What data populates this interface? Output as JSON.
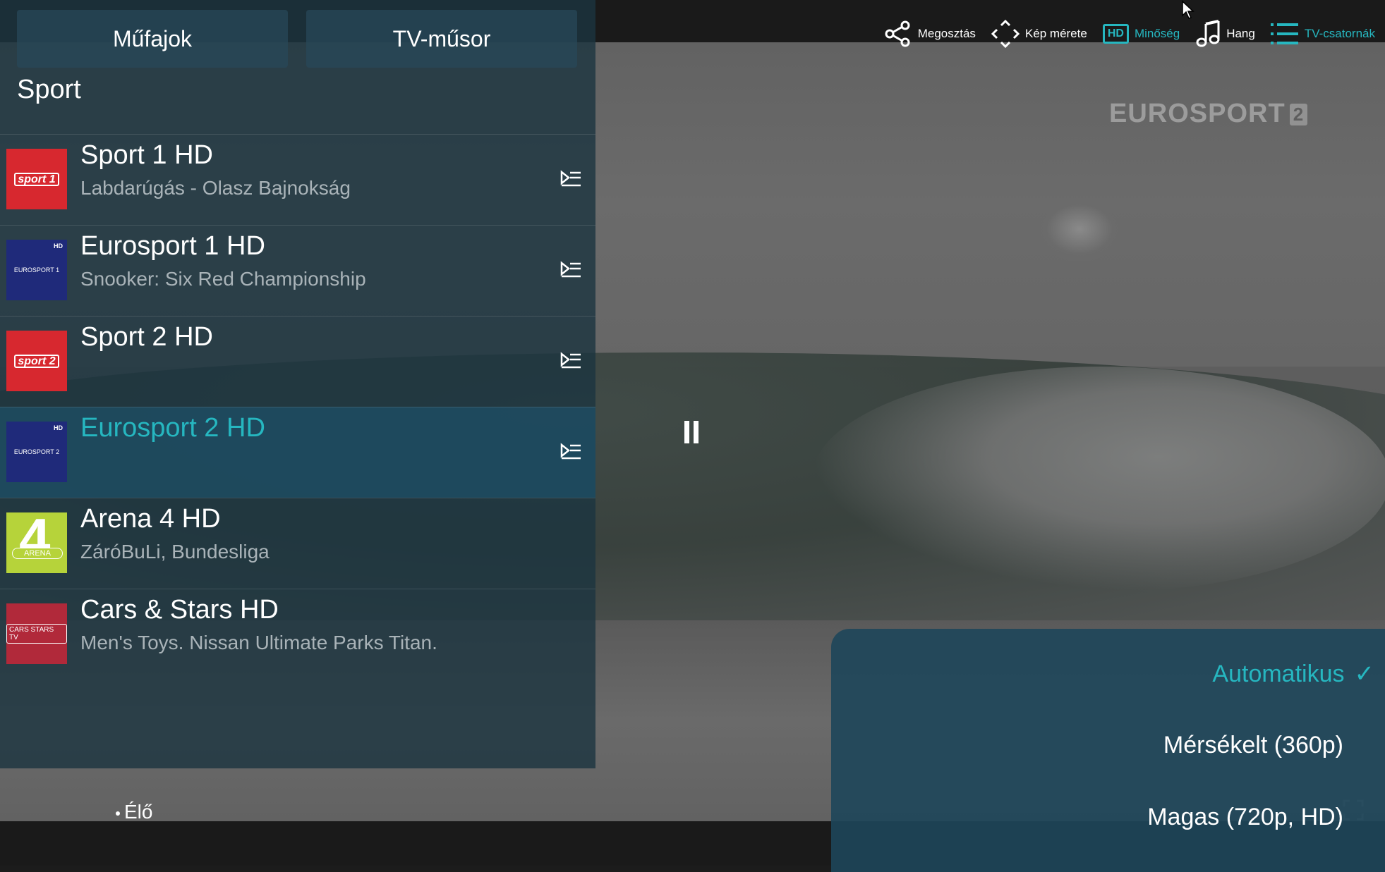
{
  "toolbar": {
    "share_label": "Megosztás",
    "aspect_label": "Kép mérete",
    "quality_badge": "HD",
    "quality_label": "Minőség",
    "audio_label": "Hang",
    "channels_label": "TV-csatornák",
    "accent_color": "#26b7c0"
  },
  "panel": {
    "genres_tab": "Műfajok",
    "guide_tab": "TV-műsor",
    "category": "Sport",
    "channels": [
      {
        "name": "Sport 1 HD",
        "program": "Labdarúgás - Olasz Bajnokság",
        "logo": "sport1",
        "logo_text": "sport 1",
        "selected": false
      },
      {
        "name": "Eurosport 1 HD",
        "program": "Snooker: Six Red Championship",
        "logo": "eurosport1",
        "logo_text": "EUROSPORT 1",
        "logo_hd": "HD",
        "selected": false
      },
      {
        "name": "Sport 2 HD",
        "program": "",
        "logo": "sport2",
        "logo_text": "sport 2",
        "selected": false
      },
      {
        "name": "Eurosport 2 HD",
        "program": "",
        "logo": "eurosport2",
        "logo_text": "EUROSPORT 2",
        "logo_hd": "HD",
        "selected": true
      },
      {
        "name": "Arena 4 HD",
        "program": "ZáróBuLi, Bundesliga",
        "logo": "arena4",
        "logo_num": "4",
        "logo_text": "ARENA",
        "selected": false
      },
      {
        "name": "Cars & Stars HD",
        "program": "Men's Toys. Nissan Ultimate Parks Titan.",
        "logo": "carsstars",
        "logo_text": "CARS STARS TV",
        "selected": false
      }
    ]
  },
  "video": {
    "watermark": "EUROSPORT",
    "watermark_num": "2"
  },
  "player": {
    "live_label": "Élő"
  },
  "quality_menu": {
    "options": [
      {
        "label": "Automatikus",
        "selected": true
      },
      {
        "label": "Mérsékelt (360p)",
        "selected": false
      },
      {
        "label": "Magas (720p, HD)",
        "selected": false
      }
    ]
  }
}
